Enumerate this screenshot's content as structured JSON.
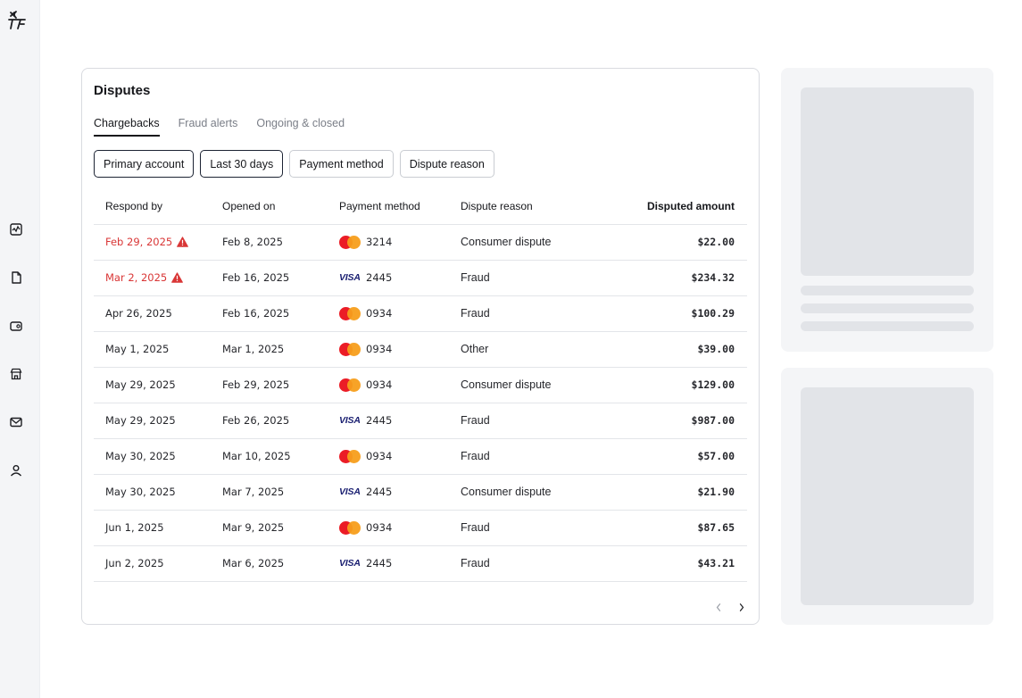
{
  "nav": {
    "items": [
      {
        "icon": "activity-icon"
      },
      {
        "icon": "document-icon"
      },
      {
        "icon": "wallet-icon"
      },
      {
        "icon": "store-icon"
      },
      {
        "icon": "mail-icon"
      },
      {
        "icon": "user-icon"
      }
    ]
  },
  "card": {
    "title": "Disputes",
    "tabs": [
      {
        "label": "Chargebacks",
        "active": true
      },
      {
        "label": "Fraud alerts",
        "active": false
      },
      {
        "label": "Ongoing & closed",
        "active": false
      }
    ],
    "filters": [
      {
        "label": "Primary account",
        "selected": true
      },
      {
        "label": "Last 30 days",
        "selected": true
      },
      {
        "label": "Payment method",
        "selected": false
      },
      {
        "label": "Dispute reason",
        "selected": false
      }
    ]
  },
  "table": {
    "headers": {
      "respond_by": "Respond by",
      "opened_on": "Opened on",
      "payment_method": "Payment method",
      "dispute_reason": "Dispute reason",
      "disputed_amount": "Disputed amount"
    },
    "rows": [
      {
        "respond_by": "Feb 29, 2025",
        "overdue": true,
        "opened_on": "Feb 8, 2025",
        "card": "mastercard",
        "last4": "3214",
        "reason": "Consumer dispute",
        "amount": "$22.00"
      },
      {
        "respond_by": "Mar 2, 2025",
        "overdue": true,
        "opened_on": "Feb 16, 2025",
        "card": "visa",
        "last4": "2445",
        "reason": "Fraud",
        "amount": "$234.32"
      },
      {
        "respond_by": "Apr 26, 2025",
        "overdue": false,
        "opened_on": "Feb 16, 2025",
        "card": "mastercard",
        "last4": "0934",
        "reason": "Fraud",
        "amount": "$100.29"
      },
      {
        "respond_by": "May 1, 2025",
        "overdue": false,
        "opened_on": "Mar 1, 2025",
        "card": "mastercard",
        "last4": "0934",
        "reason": "Other",
        "amount": "$39.00"
      },
      {
        "respond_by": "May 29, 2025",
        "overdue": false,
        "opened_on": "Feb 29, 2025",
        "card": "mastercard",
        "last4": "0934",
        "reason": "Consumer dispute",
        "amount": "$129.00"
      },
      {
        "respond_by": "May 29, 2025",
        "overdue": false,
        "opened_on": "Feb 26, 2025",
        "card": "visa",
        "last4": "2445",
        "reason": "Fraud",
        "amount": "$987.00"
      },
      {
        "respond_by": "May 30, 2025",
        "overdue": false,
        "opened_on": "Mar 10, 2025",
        "card": "mastercard",
        "last4": "0934",
        "reason": "Fraud",
        "amount": "$57.00"
      },
      {
        "respond_by": "May 30, 2025",
        "overdue": false,
        "opened_on": "Mar 7, 2025",
        "card": "visa",
        "last4": "2445",
        "reason": "Consumer dispute",
        "amount": "$21.90"
      },
      {
        "respond_by": "Jun 1, 2025",
        "overdue": false,
        "opened_on": "Mar 9, 2025",
        "card": "mastercard",
        "last4": "0934",
        "reason": "Fraud",
        "amount": "$87.65"
      },
      {
        "respond_by": "Jun 2, 2025",
        "overdue": false,
        "opened_on": "Mar 6, 2025",
        "card": "visa",
        "last4": "2445",
        "reason": "Fraud",
        "amount": "$43.21"
      }
    ]
  },
  "card_brands": {
    "visa_text": "VISA"
  },
  "pager": {
    "prev_icon": "chevron-left-icon",
    "next_icon": "chevron-right-icon"
  },
  "colors": {
    "overdue": "#d93636",
    "accent": "#1c2333",
    "skeleton": "#e2e4e8"
  }
}
